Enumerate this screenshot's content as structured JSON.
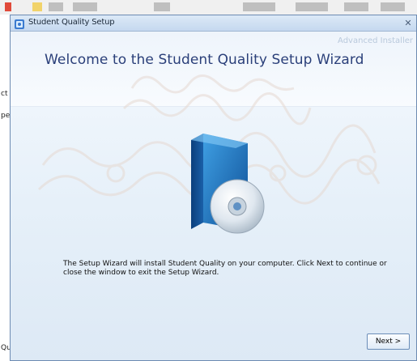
{
  "host": {
    "side_labels": [
      "ct",
      "pe",
      "Qu"
    ]
  },
  "dialog": {
    "title": "Student Quality Setup",
    "close_glyph": "✕",
    "brand_text": "Advanced Installer",
    "heading": "Welcome to the Student Quality Setup Wizard",
    "description": "The Setup Wizard will install Student Quality on your computer. Click Next to continue or close the window to exit the Setup Wizard.",
    "next_label": "Next >",
    "icons": {
      "app": "setup-app-icon",
      "product": "product-box-cd-icon"
    },
    "colors": {
      "heading": "#2a3f79",
      "button_border": "#6b8db8",
      "window_border": "#6d8bb2"
    }
  }
}
